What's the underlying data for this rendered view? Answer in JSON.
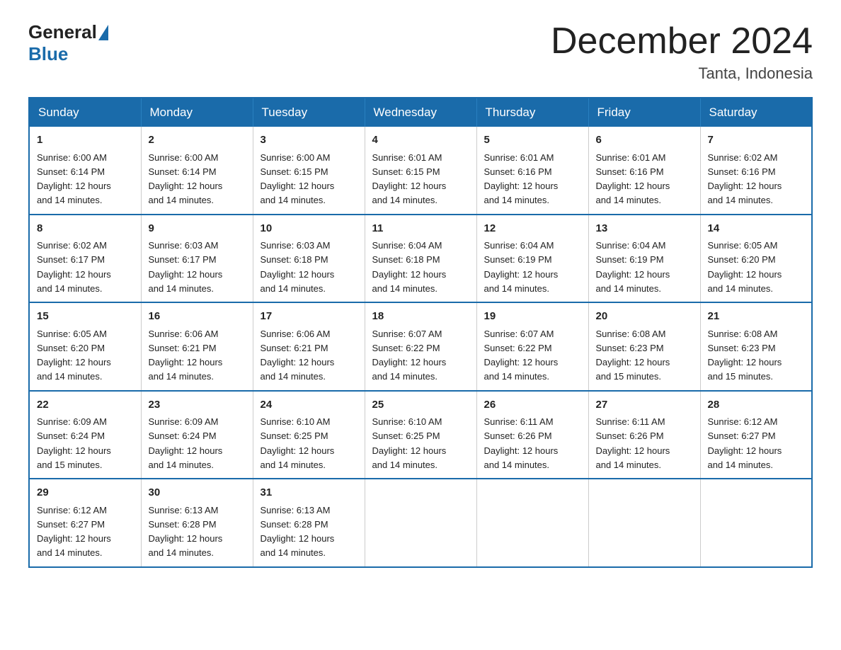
{
  "logo": {
    "text_general": "General",
    "text_blue": "Blue"
  },
  "header": {
    "month_title": "December 2024",
    "location": "Tanta, Indonesia"
  },
  "weekdays": [
    "Sunday",
    "Monday",
    "Tuesday",
    "Wednesday",
    "Thursday",
    "Friday",
    "Saturday"
  ],
  "weeks": [
    [
      {
        "day": "1",
        "sunrise": "6:00 AM",
        "sunset": "6:14 PM",
        "daylight": "12 hours and 14 minutes."
      },
      {
        "day": "2",
        "sunrise": "6:00 AM",
        "sunset": "6:14 PM",
        "daylight": "12 hours and 14 minutes."
      },
      {
        "day": "3",
        "sunrise": "6:00 AM",
        "sunset": "6:15 PM",
        "daylight": "12 hours and 14 minutes."
      },
      {
        "day": "4",
        "sunrise": "6:01 AM",
        "sunset": "6:15 PM",
        "daylight": "12 hours and 14 minutes."
      },
      {
        "day": "5",
        "sunrise": "6:01 AM",
        "sunset": "6:16 PM",
        "daylight": "12 hours and 14 minutes."
      },
      {
        "day": "6",
        "sunrise": "6:01 AM",
        "sunset": "6:16 PM",
        "daylight": "12 hours and 14 minutes."
      },
      {
        "day": "7",
        "sunrise": "6:02 AM",
        "sunset": "6:16 PM",
        "daylight": "12 hours and 14 minutes."
      }
    ],
    [
      {
        "day": "8",
        "sunrise": "6:02 AM",
        "sunset": "6:17 PM",
        "daylight": "12 hours and 14 minutes."
      },
      {
        "day": "9",
        "sunrise": "6:03 AM",
        "sunset": "6:17 PM",
        "daylight": "12 hours and 14 minutes."
      },
      {
        "day": "10",
        "sunrise": "6:03 AM",
        "sunset": "6:18 PM",
        "daylight": "12 hours and 14 minutes."
      },
      {
        "day": "11",
        "sunrise": "6:04 AM",
        "sunset": "6:18 PM",
        "daylight": "12 hours and 14 minutes."
      },
      {
        "day": "12",
        "sunrise": "6:04 AM",
        "sunset": "6:19 PM",
        "daylight": "12 hours and 14 minutes."
      },
      {
        "day": "13",
        "sunrise": "6:04 AM",
        "sunset": "6:19 PM",
        "daylight": "12 hours and 14 minutes."
      },
      {
        "day": "14",
        "sunrise": "6:05 AM",
        "sunset": "6:20 PM",
        "daylight": "12 hours and 14 minutes."
      }
    ],
    [
      {
        "day": "15",
        "sunrise": "6:05 AM",
        "sunset": "6:20 PM",
        "daylight": "12 hours and 14 minutes."
      },
      {
        "day": "16",
        "sunrise": "6:06 AM",
        "sunset": "6:21 PM",
        "daylight": "12 hours and 14 minutes."
      },
      {
        "day": "17",
        "sunrise": "6:06 AM",
        "sunset": "6:21 PM",
        "daylight": "12 hours and 14 minutes."
      },
      {
        "day": "18",
        "sunrise": "6:07 AM",
        "sunset": "6:22 PM",
        "daylight": "12 hours and 14 minutes."
      },
      {
        "day": "19",
        "sunrise": "6:07 AM",
        "sunset": "6:22 PM",
        "daylight": "12 hours and 14 minutes."
      },
      {
        "day": "20",
        "sunrise": "6:08 AM",
        "sunset": "6:23 PM",
        "daylight": "12 hours and 15 minutes."
      },
      {
        "day": "21",
        "sunrise": "6:08 AM",
        "sunset": "6:23 PM",
        "daylight": "12 hours and 15 minutes."
      }
    ],
    [
      {
        "day": "22",
        "sunrise": "6:09 AM",
        "sunset": "6:24 PM",
        "daylight": "12 hours and 15 minutes."
      },
      {
        "day": "23",
        "sunrise": "6:09 AM",
        "sunset": "6:24 PM",
        "daylight": "12 hours and 14 minutes."
      },
      {
        "day": "24",
        "sunrise": "6:10 AM",
        "sunset": "6:25 PM",
        "daylight": "12 hours and 14 minutes."
      },
      {
        "day": "25",
        "sunrise": "6:10 AM",
        "sunset": "6:25 PM",
        "daylight": "12 hours and 14 minutes."
      },
      {
        "day": "26",
        "sunrise": "6:11 AM",
        "sunset": "6:26 PM",
        "daylight": "12 hours and 14 minutes."
      },
      {
        "day": "27",
        "sunrise": "6:11 AM",
        "sunset": "6:26 PM",
        "daylight": "12 hours and 14 minutes."
      },
      {
        "day": "28",
        "sunrise": "6:12 AM",
        "sunset": "6:27 PM",
        "daylight": "12 hours and 14 minutes."
      }
    ],
    [
      {
        "day": "29",
        "sunrise": "6:12 AM",
        "sunset": "6:27 PM",
        "daylight": "12 hours and 14 minutes."
      },
      {
        "day": "30",
        "sunrise": "6:13 AM",
        "sunset": "6:28 PM",
        "daylight": "12 hours and 14 minutes."
      },
      {
        "day": "31",
        "sunrise": "6:13 AM",
        "sunset": "6:28 PM",
        "daylight": "12 hours and 14 minutes."
      },
      null,
      null,
      null,
      null
    ]
  ],
  "labels": {
    "sunrise": "Sunrise:",
    "sunset": "Sunset:",
    "daylight": "Daylight:"
  }
}
